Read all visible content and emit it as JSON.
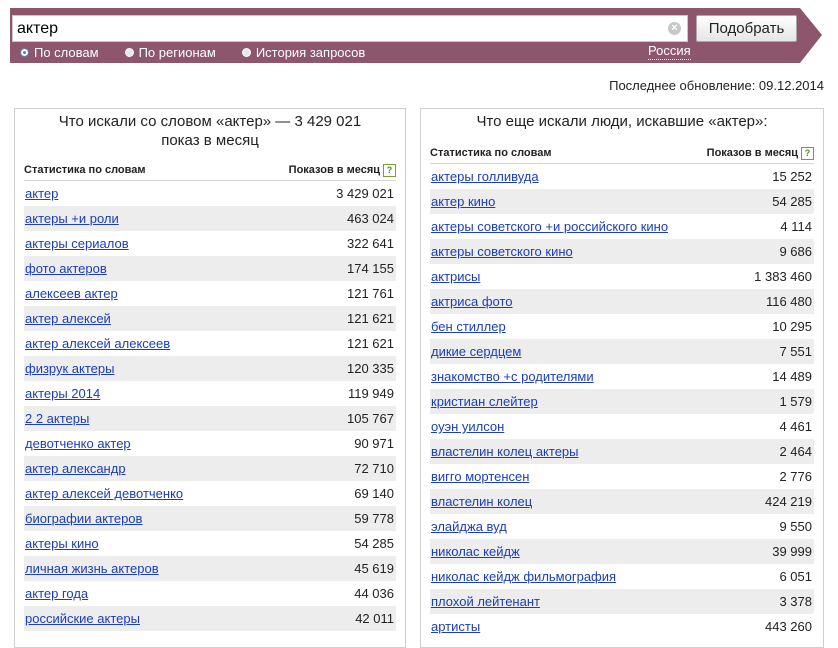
{
  "search": {
    "query": "актер",
    "button_label": "Подобрать",
    "clear_glyph": "×",
    "modes": [
      {
        "label": "По словам",
        "active": true
      },
      {
        "label": "По регионам",
        "active": false
      },
      {
        "label": "История запросов",
        "active": false
      }
    ],
    "region": "Россия"
  },
  "updated": "Последнее обновление: 09.12.2014",
  "left": {
    "title_line1": "Что искали со словом «актер» — 3 429 021",
    "title_line2": "показ в месяц",
    "col_phrase": "Статистика по словам",
    "col_count": "Показов в месяц",
    "help": "?",
    "rows": [
      {
        "phrase": "актер",
        "count": "3 429 021"
      },
      {
        "phrase": "актеры +и роли",
        "count": "463 024"
      },
      {
        "phrase": "актеры сериалов",
        "count": "322 641"
      },
      {
        "phrase": "фото актеров",
        "count": "174 155"
      },
      {
        "phrase": "алексеев актер",
        "count": "121 761"
      },
      {
        "phrase": "актер алексей",
        "count": "121 621"
      },
      {
        "phrase": "актер алексей алексеев",
        "count": "121 621"
      },
      {
        "phrase": "физрук актеры",
        "count": "120 335"
      },
      {
        "phrase": "актеры 2014",
        "count": "119 949"
      },
      {
        "phrase": "2 2 актеры",
        "count": "105 767"
      },
      {
        "phrase": "девотченко актер",
        "count": "90 971"
      },
      {
        "phrase": "актер александр",
        "count": "72 710"
      },
      {
        "phrase": "актер алексей девотченко",
        "count": "69 140"
      },
      {
        "phrase": "биографии актеров",
        "count": "59 778"
      },
      {
        "phrase": "актеры кино",
        "count": "54 285"
      },
      {
        "phrase": "личная жизнь актеров",
        "count": "45 619"
      },
      {
        "phrase": "актер года",
        "count": "44 036"
      },
      {
        "phrase": "российские актеры",
        "count": "42 011"
      }
    ]
  },
  "right": {
    "title": "Что еще искали люди, искавшие «актер»:",
    "col_phrase": "Статистика по словам",
    "col_count": "Показов в месяц",
    "help": "?",
    "rows": [
      {
        "phrase": "актеры голливуда",
        "count": "15 252"
      },
      {
        "phrase": "актер кино",
        "count": "54 285"
      },
      {
        "phrase": "актеры советского +и российского кино",
        "count": "4 114"
      },
      {
        "phrase": "актеры советского кино",
        "count": "9 686"
      },
      {
        "phrase": "актрисы",
        "count": "1 383 460"
      },
      {
        "phrase": "актриса фото",
        "count": "116 480"
      },
      {
        "phrase": "бен стиллер",
        "count": "10 295"
      },
      {
        "phrase": "дикие сердцем",
        "count": "7 551"
      },
      {
        "phrase": "знакомство +с родителями",
        "count": "14 489"
      },
      {
        "phrase": "кристиан слейтер",
        "count": "1 579"
      },
      {
        "phrase": "оуэн уилсон",
        "count": "4 461"
      },
      {
        "phrase": "властелин колец актеры",
        "count": "2 464"
      },
      {
        "phrase": "вигго мортенсен",
        "count": "2 776"
      },
      {
        "phrase": "властелин колец",
        "count": "424 219"
      },
      {
        "phrase": "элайджа вуд",
        "count": "9 550"
      },
      {
        "phrase": "николас кейдж",
        "count": "39 999"
      },
      {
        "phrase": "николас кейдж фильмография",
        "count": "6 051"
      },
      {
        "phrase": "плохой лейтенант",
        "count": "3 378"
      },
      {
        "phrase": "артисты",
        "count": "443 260"
      }
    ]
  }
}
